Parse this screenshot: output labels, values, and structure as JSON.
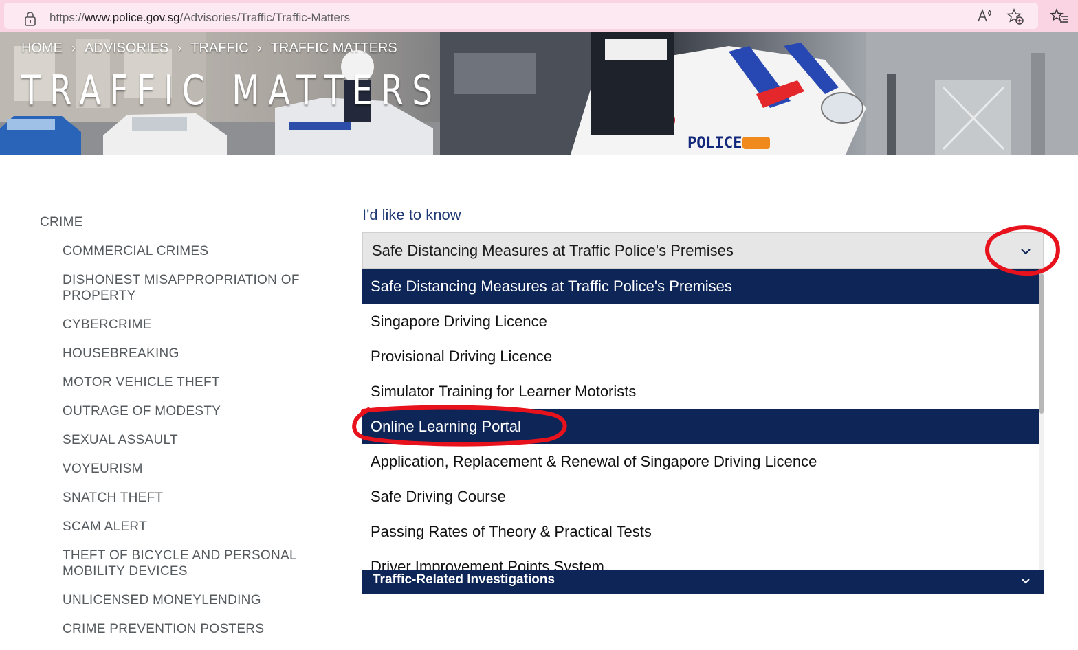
{
  "browser": {
    "url_prefix": "https://",
    "url_host": "www.police.gov.sg",
    "url_path": "/Advisories/Traffic/Traffic-Matters",
    "icons": [
      "lock-icon",
      "read-aloud-icon",
      "favorite-add-icon",
      "favorites-icon"
    ]
  },
  "breadcrumb": {
    "items": [
      "HOME",
      "ADVISORIES",
      "TRAFFIC",
      "TRAFFIC MATTERS"
    ],
    "separator": "›"
  },
  "hero": {
    "title": "TRAFFIC MATTERS",
    "police_marking": "POLICE"
  },
  "sidebar": {
    "heading": "CRIME",
    "items": [
      "COMMERCIAL CRIMES",
      "DISHONEST MISAPPROPRIATION OF PROPERTY",
      "CYBERCRIME",
      "HOUSEBREAKING",
      "MOTOR VEHICLE THEFT",
      "OUTRAGE OF MODESTY",
      "SEXUAL ASSAULT",
      "VOYEURISM",
      "SNATCH THEFT",
      "SCAM ALERT",
      "THEFT OF BICYCLE AND PERSONAL MOBILITY DEVICES",
      "UNLICENSED MONEYLENDING",
      "CRIME PREVENTION POSTERS"
    ]
  },
  "main": {
    "label": "I'd like to know",
    "select": {
      "value": "Safe Distancing Measures at Traffic Police's Premises",
      "options": [
        "Safe Distancing Measures at Traffic Police's Premises",
        "Singapore Driving Licence",
        "Provisional Driving Licence",
        "Simulator Training for Learner Motorists",
        "Online Learning Portal",
        "Application, Replacement & Renewal of Singapore Driving Licence",
        "Safe Driving Course",
        "Passing Rates of Theory & Practical Tests",
        "Driver Improvement Points System"
      ],
      "selected_index": 0,
      "hovered_index": 4
    },
    "accordion": {
      "title": "Traffic-Related Investigations"
    }
  },
  "colors": {
    "navy": "#0e2557",
    "label_blue": "#1f3a73",
    "sidebar_text": "#555a5e",
    "annotation_red": "#e8121c",
    "browser_bar": "#fbd4e4"
  }
}
